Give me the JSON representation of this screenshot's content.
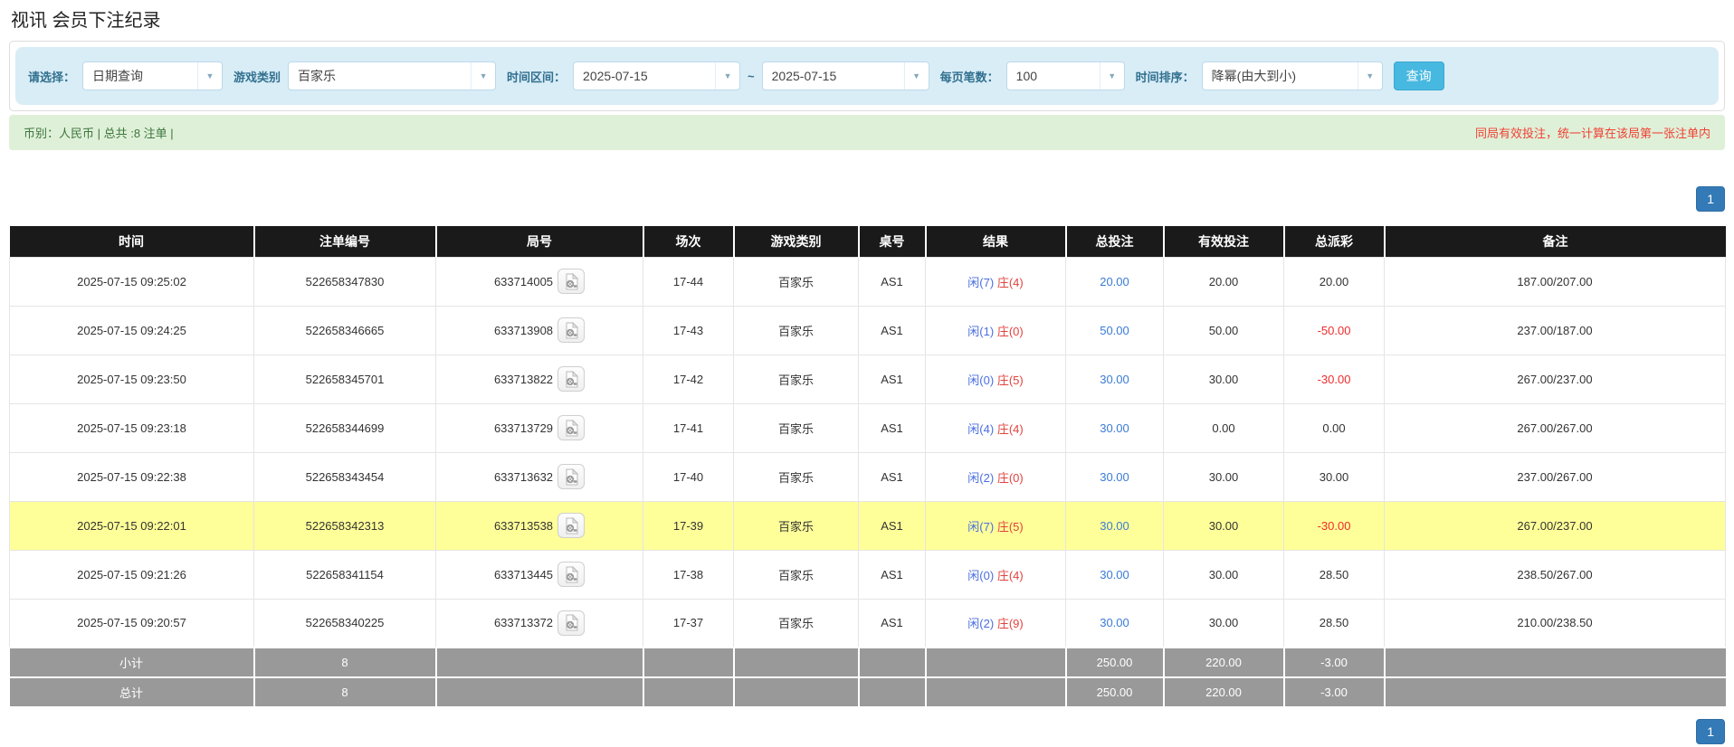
{
  "page_title": "视讯 会员下注纪录",
  "filter_bar": {
    "select_label": "请选择：",
    "select_value": "日期查询",
    "game_type_label": "游戏类别",
    "game_type_value": "百家乐",
    "time_range_label": "时间区间：",
    "date_from": "2025-07-15",
    "range_separator": "~",
    "date_to": "2025-07-15",
    "page_size_label": "每页笔数：",
    "page_size_value": "100",
    "time_sort_label": "时间排序：",
    "time_sort_value": "降幂(由大到小)",
    "query_button_label": "查询"
  },
  "info_bar": {
    "currency_summary": "币别：人民币 | 总共 :8 注单 |",
    "notice": "同局有效投注，统一计算在该局第一张注单内"
  },
  "pagination": {
    "page_label": "1"
  },
  "table": {
    "headers": [
      "时间",
      "注单编号",
      "局号",
      "场次",
      "游戏类别",
      "桌号",
      "结果",
      "总投注",
      "有效投注",
      "总派彩",
      "备注"
    ],
    "rows": [
      {
        "time": "2025-07-15 09:25:02",
        "bet_id": "522658347830",
        "round_id": "633714005",
        "session": "17-44",
        "game_type": "百家乐",
        "table_no": "AS1",
        "result_player": "闲(7)",
        "result_banker": "庄(4)",
        "total_bet": "20.00",
        "valid_bet": "20.00",
        "total_payout": "20.00",
        "note": "187.00/207.00",
        "highlight": false
      },
      {
        "time": "2025-07-15 09:24:25",
        "bet_id": "522658346665",
        "round_id": "633713908",
        "session": "17-43",
        "game_type": "百家乐",
        "table_no": "AS1",
        "result_player": "闲(1)",
        "result_banker": "庄(0)",
        "total_bet": "50.00",
        "valid_bet": "50.00",
        "total_payout": "-50.00",
        "note": "237.00/187.00",
        "highlight": false
      },
      {
        "time": "2025-07-15 09:23:50",
        "bet_id": "522658345701",
        "round_id": "633713822",
        "session": "17-42",
        "game_type": "百家乐",
        "table_no": "AS1",
        "result_player": "闲(0)",
        "result_banker": "庄(5)",
        "total_bet": "30.00",
        "valid_bet": "30.00",
        "total_payout": "-30.00",
        "note": "267.00/237.00",
        "highlight": false
      },
      {
        "time": "2025-07-15 09:23:18",
        "bet_id": "522658344699",
        "round_id": "633713729",
        "session": "17-41",
        "game_type": "百家乐",
        "table_no": "AS1",
        "result_player": "闲(4)",
        "result_banker": "庄(4)",
        "total_bet": "30.00",
        "valid_bet": "0.00",
        "total_payout": "0.00",
        "note": "267.00/267.00",
        "highlight": false
      },
      {
        "time": "2025-07-15 09:22:38",
        "bet_id": "522658343454",
        "round_id": "633713632",
        "session": "17-40",
        "game_type": "百家乐",
        "table_no": "AS1",
        "result_player": "闲(2)",
        "result_banker": "庄(0)",
        "total_bet": "30.00",
        "valid_bet": "30.00",
        "total_payout": "30.00",
        "note": "237.00/267.00",
        "highlight": false
      },
      {
        "time": "2025-07-15 09:22:01",
        "bet_id": "522658342313",
        "round_id": "633713538",
        "session": "17-39",
        "game_type": "百家乐",
        "table_no": "AS1",
        "result_player": "闲(7)",
        "result_banker": "庄(5)",
        "total_bet": "30.00",
        "valid_bet": "30.00",
        "total_payout": "-30.00",
        "note": "267.00/237.00",
        "highlight": true
      },
      {
        "time": "2025-07-15 09:21:26",
        "bet_id": "522658341154",
        "round_id": "633713445",
        "session": "17-38",
        "game_type": "百家乐",
        "table_no": "AS1",
        "result_player": "闲(0)",
        "result_banker": "庄(4)",
        "total_bet": "30.00",
        "valid_bet": "30.00",
        "total_payout": "28.50",
        "note": "238.50/267.00",
        "highlight": false
      },
      {
        "time": "2025-07-15 09:20:57",
        "bet_id": "522658340225",
        "round_id": "633713372",
        "session": "17-37",
        "game_type": "百家乐",
        "table_no": "AS1",
        "result_player": "闲(2)",
        "result_banker": "庄(9)",
        "total_bet": "30.00",
        "valid_bet": "30.00",
        "total_payout": "28.50",
        "note": "210.00/238.50",
        "highlight": false
      }
    ],
    "subtotal": {
      "label": "小计",
      "count": "8",
      "total_bet": "250.00",
      "valid_bet": "220.00",
      "total_payout": "-3.00"
    },
    "grand_total": {
      "label": "总计",
      "count": "8",
      "total_bet": "250.00",
      "valid_bet": "220.00",
      "total_payout": "-3.00"
    }
  },
  "colors": {
    "filter_bar_bg": "#d9edf7",
    "filter_label": "#31708f",
    "query_button_bg": "#47b8e0",
    "info_bar_bg": "#dff0d8",
    "info_text_green": "#3c763d",
    "notice_red": "#f04134",
    "header_bg": "#1a1a1a",
    "summary_row_bg": "#999999",
    "highlight_yellow": "#ffff99",
    "player_blue": "#4a6ee0",
    "banker_red": "#e0433e",
    "amount_link_blue": "#3a7bd5",
    "negative_red": "#f02b2b",
    "pagination_blue": "#337ab7"
  }
}
